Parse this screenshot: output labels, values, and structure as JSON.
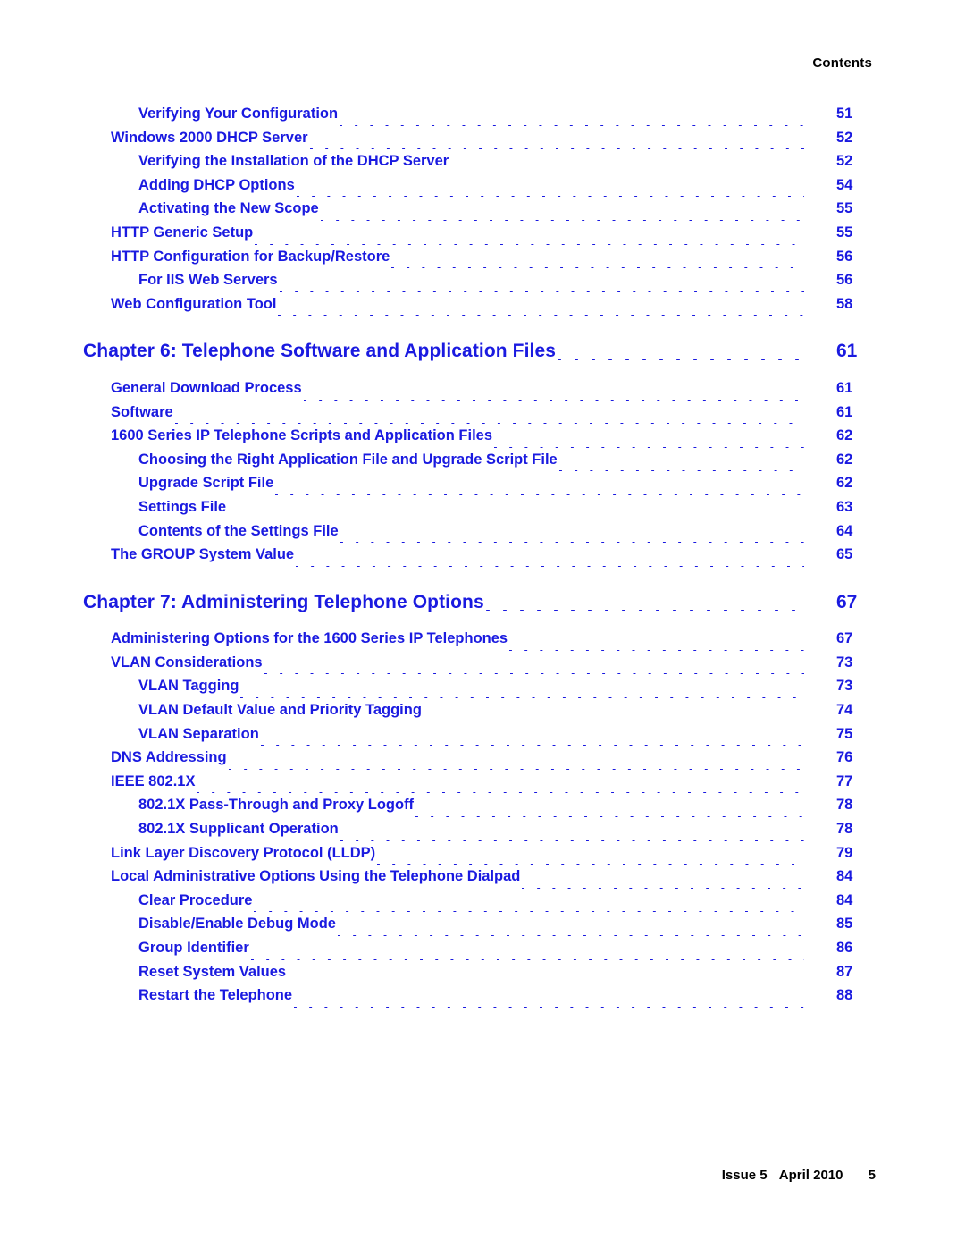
{
  "header": {
    "title": "Contents"
  },
  "footer": {
    "issue": "Issue 5",
    "date": "April 2010",
    "page_number": "5"
  },
  "toc": {
    "entries": [
      {
        "title": "Verifying Your Configuration",
        "page": "51",
        "level": 2
      },
      {
        "title": "Windows 2000 DHCP Server",
        "page": "52",
        "level": 1
      },
      {
        "title": "Verifying the Installation of the DHCP Server",
        "page": "52",
        "level": 2
      },
      {
        "title": "Adding DHCP Options",
        "page": "54",
        "level": 2
      },
      {
        "title": "Activating the New Scope",
        "page": "55",
        "level": 2
      },
      {
        "title": "HTTP Generic Setup",
        "page": "55",
        "level": 1
      },
      {
        "title": "HTTP Configuration for Backup/Restore",
        "page": "56",
        "level": 1
      },
      {
        "title": "For IIS Web Servers",
        "page": "56",
        "level": 2
      },
      {
        "title": "Web Configuration Tool",
        "page": "58",
        "level": 1
      },
      {
        "title": "Chapter 6: Telephone Software and Application Files",
        "page": "61",
        "level": 0
      },
      {
        "title": "General Download Process",
        "page": "61",
        "level": 1
      },
      {
        "title": "Software",
        "page": "61",
        "level": 1
      },
      {
        "title": "1600 Series IP Telephone Scripts and Application Files",
        "page": "62",
        "level": 1
      },
      {
        "title": "Choosing the Right Application File and Upgrade Script File",
        "page": "62",
        "level": 2
      },
      {
        "title": "Upgrade Script File",
        "page": "62",
        "level": 2
      },
      {
        "title": "Settings File",
        "page": "63",
        "level": 2
      },
      {
        "title": "Contents of the Settings File",
        "page": "64",
        "level": 2
      },
      {
        "title": "The GROUP System Value",
        "page": "65",
        "level": 1
      },
      {
        "title": "Chapter 7: Administering Telephone Options",
        "page": "67",
        "level": 0
      },
      {
        "title": "Administering Options for the 1600 Series IP Telephones",
        "page": "67",
        "level": 1
      },
      {
        "title": "VLAN Considerations",
        "page": "73",
        "level": 1
      },
      {
        "title": "VLAN Tagging",
        "page": "73",
        "level": 2
      },
      {
        "title": "VLAN Default Value and Priority Tagging",
        "page": "74",
        "level": 2
      },
      {
        "title": "VLAN Separation",
        "page": "75",
        "level": 2
      },
      {
        "title": "DNS Addressing",
        "page": "76",
        "level": 1
      },
      {
        "title": "IEEE 802.1X",
        "page": "77",
        "level": 1
      },
      {
        "title": "802.1X Pass-Through and Proxy Logoff",
        "page": "78",
        "level": 2
      },
      {
        "title": "802.1X Supplicant Operation",
        "page": "78",
        "level": 2
      },
      {
        "title": "Link Layer Discovery Protocol (LLDP)",
        "page": "79",
        "level": 1
      },
      {
        "title": "Local Administrative Options Using the Telephone Dialpad",
        "page": "84",
        "level": 1
      },
      {
        "title": "Clear Procedure",
        "page": "84",
        "level": 2
      },
      {
        "title": "Disable/Enable Debug Mode",
        "page": "85",
        "level": 2
      },
      {
        "title": "Group Identifier",
        "page": "86",
        "level": 2
      },
      {
        "title": "Reset System Values",
        "page": "87",
        "level": 2
      },
      {
        "title": "Restart the Telephone",
        "page": "88",
        "level": 2
      }
    ]
  },
  "colors": {
    "link_blue": "#1a1ae0",
    "text_black": "#000000",
    "page_background": "#ffffff"
  }
}
